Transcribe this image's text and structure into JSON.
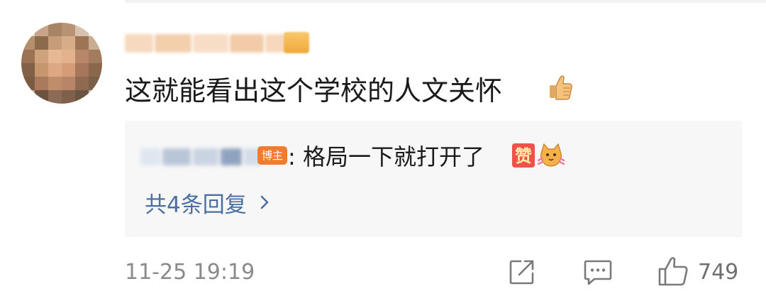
{
  "comment": {
    "text": "这就能看出这个学校的人文关怀",
    "emoji": "thumbs-up-emoji",
    "timestamp": "11-25 19:19",
    "like_count": "749"
  },
  "reply": {
    "badge_label": "博主",
    "separator": ":",
    "text": "格局一下就打开了",
    "emojis": [
      "zan-emoji",
      "cat-emoji"
    ],
    "zan_char": "赞"
  },
  "more_replies": {
    "label": "共4条回复"
  },
  "colors": {
    "link": "#4a6fa0",
    "author_badge": "#f47b2c",
    "reply_bg": "#f7f7f7",
    "meta_text": "#8a8a8a"
  },
  "icons": {
    "share": "share-icon",
    "comment": "comment-icon",
    "like": "like-icon",
    "chevron": "chevron-right-icon"
  }
}
